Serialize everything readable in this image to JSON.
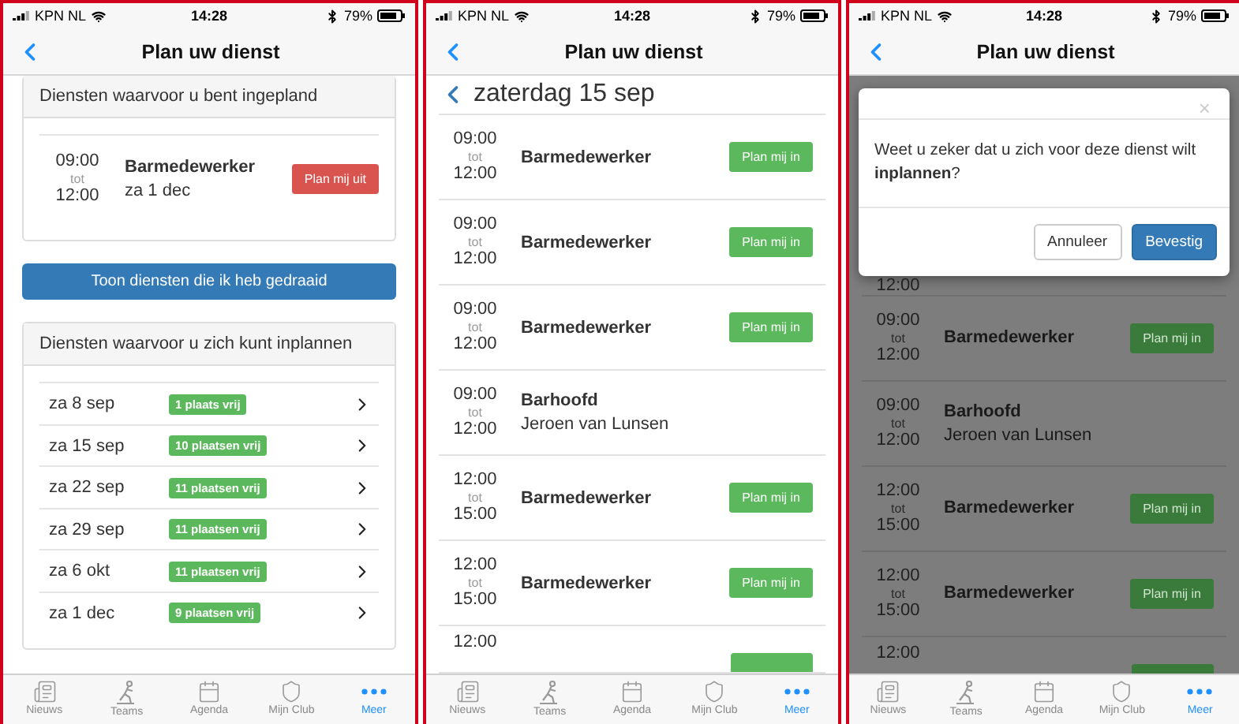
{
  "screens": [
    {
      "kind": "overview",
      "status": {
        "carrier": "KPN NL",
        "time": "14:28",
        "battery": "79%"
      },
      "title": "Plan uw dienst",
      "planned": {
        "header": "Diensten waarvoor u bent ingepland",
        "items": [
          {
            "start": "09:00",
            "sep": "tot",
            "end": "12:00",
            "name": "Barmedewerker",
            "date": "za 1 dec",
            "button": "Plan mij uit"
          }
        ]
      },
      "history_button": "Toon diensten die ik heb gedraaid",
      "available": {
        "header": "Diensten waarvoor u zich kunt inplannen",
        "items": [
          {
            "date": "za 8 sep",
            "badge": "1 plaats vrij"
          },
          {
            "date": "za 15 sep",
            "badge": "10 plaatsen vrij"
          },
          {
            "date": "za 22 sep",
            "badge": "11 plaatsen vrij"
          },
          {
            "date": "za 29 sep",
            "badge": "11 plaatsen vrij"
          },
          {
            "date": "za 6 okt",
            "badge": "11 plaatsen vrij"
          },
          {
            "date": "za 1 dec",
            "badge": "9 plaatsen vrij"
          }
        ]
      },
      "tabs": [
        {
          "label": "Nieuws",
          "selected": false
        },
        {
          "label": "Teams",
          "selected": false
        },
        {
          "label": "Agenda",
          "selected": false
        },
        {
          "label": "Mijn Club",
          "selected": false
        },
        {
          "label": "Meer",
          "selected": true
        }
      ]
    },
    {
      "kind": "day",
      "status": {
        "carrier": "KPN NL",
        "time": "14:28",
        "battery": "79%"
      },
      "title": "Plan uw dienst",
      "day": "zaterdag 15 sep",
      "rows": [
        {
          "kind": "full",
          "start": "09:00",
          "sep": "tot",
          "end": "12:00",
          "name": "Barmedewerker",
          "button": "Plan mij in"
        },
        {
          "kind": "full",
          "start": "09:00",
          "sep": "tot",
          "end": "12:00",
          "name": "Barmedewerker",
          "button": "Plan mij in"
        },
        {
          "kind": "full",
          "start": "09:00",
          "sep": "tot",
          "end": "12:00",
          "name": "Barmedewerker",
          "button": "Plan mij in"
        },
        {
          "kind": "full",
          "start": "09:00",
          "sep": "tot",
          "end": "12:00",
          "name": "Barhoofd",
          "person": "Jeroen van Lunsen"
        },
        {
          "kind": "full",
          "start": "12:00",
          "sep": "tot",
          "end": "15:00",
          "name": "Barmedewerker",
          "button": "Plan mij in"
        },
        {
          "kind": "full",
          "start": "12:00",
          "sep": "tot",
          "end": "15:00",
          "name": "Barmedewerker",
          "button": "Plan mij in"
        },
        {
          "kind": "head",
          "start": "12:00"
        }
      ],
      "tabs": [
        {
          "label": "Nieuws",
          "selected": false
        },
        {
          "label": "Teams",
          "selected": false
        },
        {
          "label": "Agenda",
          "selected": false
        },
        {
          "label": "Mijn Club",
          "selected": false
        },
        {
          "label": "Meer",
          "selected": true
        }
      ]
    },
    {
      "kind": "dialog",
      "status": {
        "carrier": "KPN NL",
        "time": "14:28",
        "battery": "79%"
      },
      "title": "Plan uw dienst",
      "dialog": {
        "close": "×",
        "message": "Weet u zeker dat u zich voor deze dienst wilt **inplannen**?",
        "cancel": "Annuleer",
        "confirm": "Bevestig"
      },
      "rows": [
        {
          "kind": "tail",
          "end": "12:00"
        },
        {
          "kind": "full",
          "start": "09:00",
          "sep": "tot",
          "end": "12:00",
          "name": "Barmedewerker",
          "button": "Plan mij in"
        },
        {
          "kind": "full",
          "start": "09:00",
          "sep": "tot",
          "end": "12:00",
          "name": "Barhoofd",
          "person": "Jeroen van Lunsen"
        },
        {
          "kind": "full",
          "start": "12:00",
          "sep": "tot",
          "end": "15:00",
          "name": "Barmedewerker",
          "button": "Plan mij in"
        },
        {
          "kind": "full",
          "start": "12:00",
          "sep": "tot",
          "end": "15:00",
          "name": "Barmedewerker",
          "button": "Plan mij in"
        },
        {
          "kind": "head",
          "start": "12:00"
        }
      ],
      "tabs": [
        {
          "label": "Nieuws",
          "selected": false
        },
        {
          "label": "Teams",
          "selected": false
        },
        {
          "label": "Agenda",
          "selected": false
        },
        {
          "label": "Mijn Club",
          "selected": false
        },
        {
          "label": "Meer",
          "selected": true
        }
      ]
    }
  ]
}
